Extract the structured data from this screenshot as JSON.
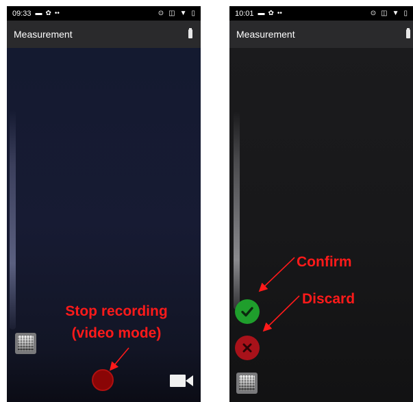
{
  "left_screen": {
    "status_time": "09:33",
    "status_icons": [
      "image-icon",
      "gear-icon",
      "more-dots-icon"
    ],
    "status_right_icons": [
      "location-icon",
      "vibrate-icon",
      "wifi-icon",
      "battery-status-icon"
    ],
    "title": "Measurement",
    "annotation": [
      "Stop recording",
      "(video mode)"
    ]
  },
  "right_screen": {
    "status_time": "10:01",
    "status_icons": [
      "image-icon",
      "gear-icon",
      "more-dots-icon"
    ],
    "status_right_icons": [
      "location-icon",
      "vibrate-icon",
      "wifi-icon",
      "battery-status-icon"
    ],
    "title": "Measurement",
    "annotations": {
      "confirm": "Confirm",
      "discard": "Discard"
    }
  },
  "colors": {
    "annotation": "#ff1a1a",
    "record": "#8a0506",
    "confirm": "#1f9e2c",
    "discard": "#a8121a",
    "app_bar": "#2a2a2c"
  }
}
